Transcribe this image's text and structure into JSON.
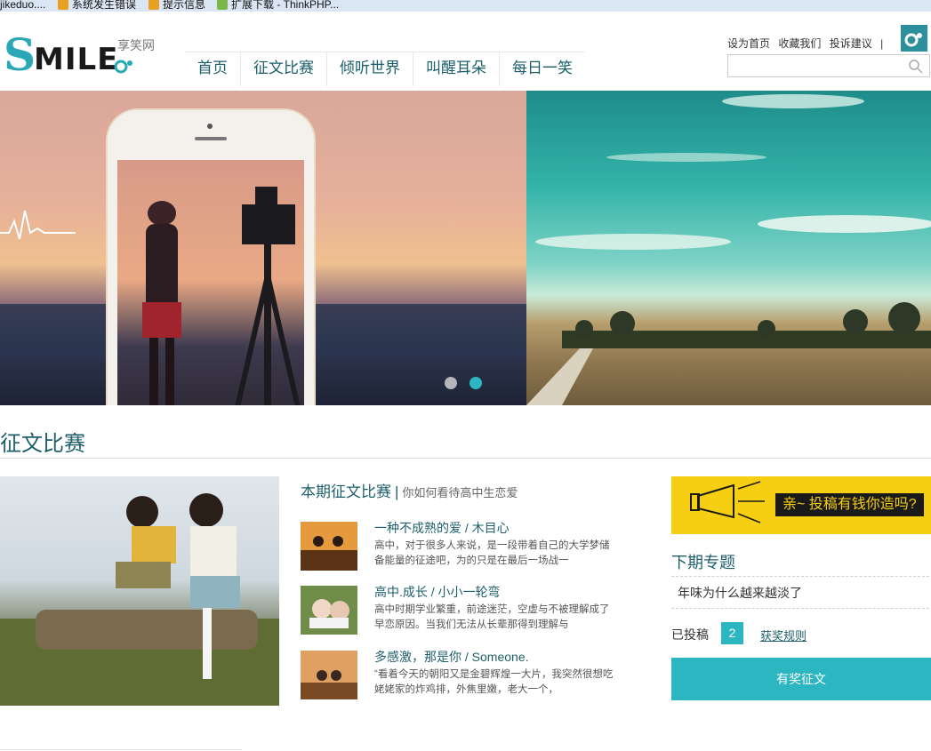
{
  "bookmarks": [
    {
      "label": "jikeduo....",
      "icon": "none"
    },
    {
      "label": "系统发生错误",
      "icon": "bookmark-icon-orange"
    },
    {
      "label": "提示信息",
      "icon": "bookmark-icon-orange"
    },
    {
      "label": "扩展下载 - ThinkPHP...",
      "icon": "bookmark-icon-green"
    }
  ],
  "header": {
    "logo_main": "MILE",
    "logo_initial": "S",
    "logo_cn": "享笑网",
    "nav": [
      "首页",
      "征文比赛",
      "倾听世界",
      "叫醒耳朵",
      "每日一笑"
    ],
    "top_links": [
      "设为首页",
      "收藏我们",
      "投诉建议"
    ],
    "top_links_sep": "|",
    "search_placeholder": ""
  },
  "banner": {
    "active_slide": 2,
    "slide_count": 2
  },
  "section": {
    "title": "征文比赛"
  },
  "contest": {
    "title": "本期征文比赛",
    "separator": "|",
    "subtitle": "你如何看待高中生恋爱",
    "articles": [
      {
        "title": "一种不成熟的爱 / 木目心",
        "excerpt": "高中，对于很多人来说，是一段带着自己的大学梦储备能量的征途吧，为的只是在最后一场战一"
      },
      {
        "title": "高中.成长 / 小小一轮弯",
        "excerpt": "高中时期学业繁重，前途迷茫，空虚与不被理解成了早恋原因。当我们无法从长辈那得到理解与"
      },
      {
        "title": "多感激，那是你 / Someone.",
        "excerpt": "“看着今天的朝阳又是金碧辉煌一大片，我突然很想吃姥姥家的炸鸡排，外焦里嫩，老大一个，"
      }
    ]
  },
  "sidebar": {
    "ad_text": "亲~ 投稿有钱你造吗?",
    "next_title": "下期专题",
    "next_topic": "年味为什么越来越淡了",
    "submitted_label": "已投稿",
    "submitted_count": "2",
    "rules_link": "获奖规则",
    "prize_button": "有奖征文"
  },
  "colors": {
    "brand_teal": "#2bb6c1",
    "title_teal": "#1f5f6b",
    "ad_yellow": "#f6cf12"
  }
}
